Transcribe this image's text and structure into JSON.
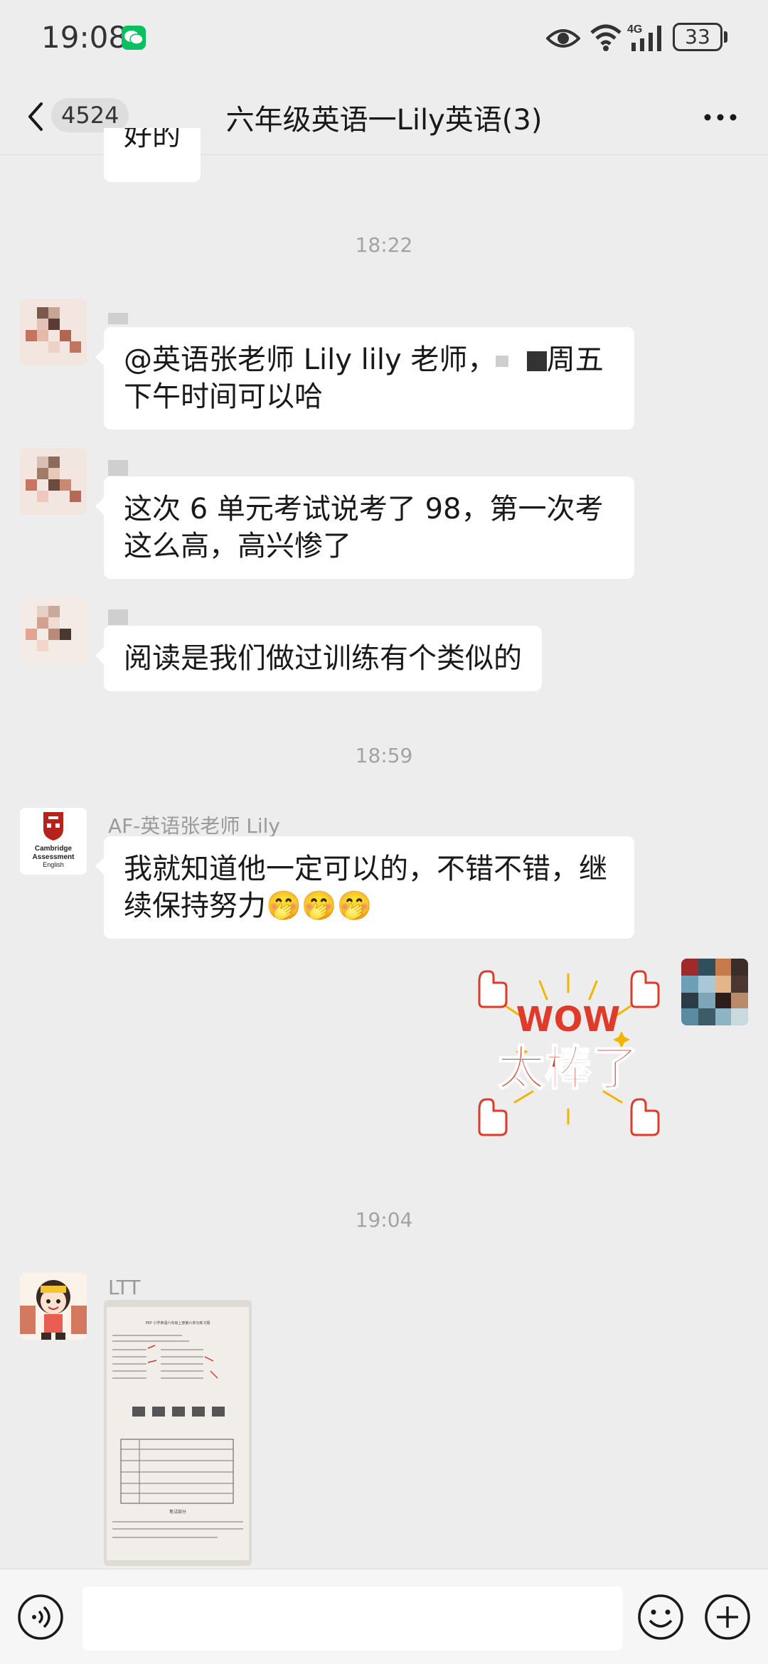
{
  "status_bar": {
    "time": "19:08",
    "battery": "33",
    "network": "4G"
  },
  "header": {
    "unread_count": "4524",
    "title": "六年级英语一Lily英语(3)"
  },
  "messages": {
    "partial_top": "好的",
    "time_1": "18:22",
    "time_2": "18:59",
    "time_3": "19:04",
    "msg1_pre": "@英语张老师 Lily lily 老师，",
    "msg1_post": "周五下午时间可以哈",
    "msg2": "这次 6 单元考试说考了 98，第一次考这么高，高兴惨了",
    "msg3": "阅读是我们做过训练有个类似的",
    "teacher_name": "AF-英语张老师 Lily",
    "msg4": "我就知道他一定可以的，不错不错，继续保持努力🤭🤭🤭",
    "sticker_top": "WOW",
    "sticker_bottom": "太棒了",
    "ltt_name": "LTT"
  },
  "teacher_avatar": {
    "line1": "Cambridge",
    "line2": "Assessment",
    "line3": "English"
  },
  "photo_doc": {
    "heading": "PEP 小学英语六年级上册第六单元练习题",
    "section": "笔试部分"
  },
  "input": {
    "placeholder": ""
  },
  "colors": {
    "background": "#ededed",
    "bubble": "#ffffff",
    "wechat_green": "#07c160",
    "sticker_red": "#e03b2a"
  }
}
